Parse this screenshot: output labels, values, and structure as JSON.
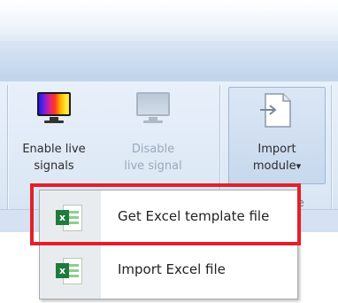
{
  "ribbon": {
    "buttons": [
      {
        "label_line1": "Enable live",
        "label_line2": "signals",
        "icon": "monitor-color-bars-icon",
        "enabled": true
      },
      {
        "label_line1": "Disable",
        "label_line2": "live signal",
        "icon": "monitor-gray-icon",
        "enabled": false
      },
      {
        "label_line1": "Import",
        "label_line2": "module",
        "icon": "import-document-icon",
        "enabled": true,
        "dropdown_arrow": "▾"
      }
    ],
    "group_label_fragment": "le"
  },
  "menu": {
    "items": [
      {
        "label": "Get Excel template file",
        "icon": "excel-icon",
        "badge": "x"
      },
      {
        "label": "Import Excel file",
        "icon": "excel-icon",
        "badge": "x"
      }
    ]
  },
  "colors": {
    "highlight": "#e3202a",
    "excel_green": "#1f7a3e",
    "ribbon_bg": "#dde8f5"
  }
}
